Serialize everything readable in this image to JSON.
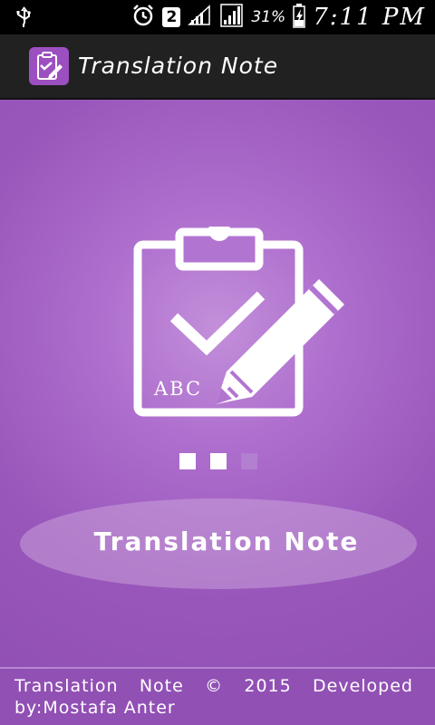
{
  "status_bar": {
    "sim_badge": "2",
    "battery_percent": "31%",
    "time": "7:11 PM",
    "icons": [
      "usb-icon",
      "alarm-icon",
      "signal-icon",
      "battery-charging-icon"
    ]
  },
  "action_bar": {
    "title": "Translation Note",
    "icon": "clipboard-edit-icon"
  },
  "splash": {
    "logo_text": "ABC",
    "brand": "Translation Note",
    "page_indicator": {
      "active": 2,
      "total": 3
    }
  },
  "footer": {
    "text": "Translation Note © 2015 Developed by:Mostafa Anter"
  },
  "colors": {
    "primary": "#9150b4",
    "accent_light": "#c38fda",
    "status_bar": "#000000",
    "action_bar": "#212121"
  }
}
